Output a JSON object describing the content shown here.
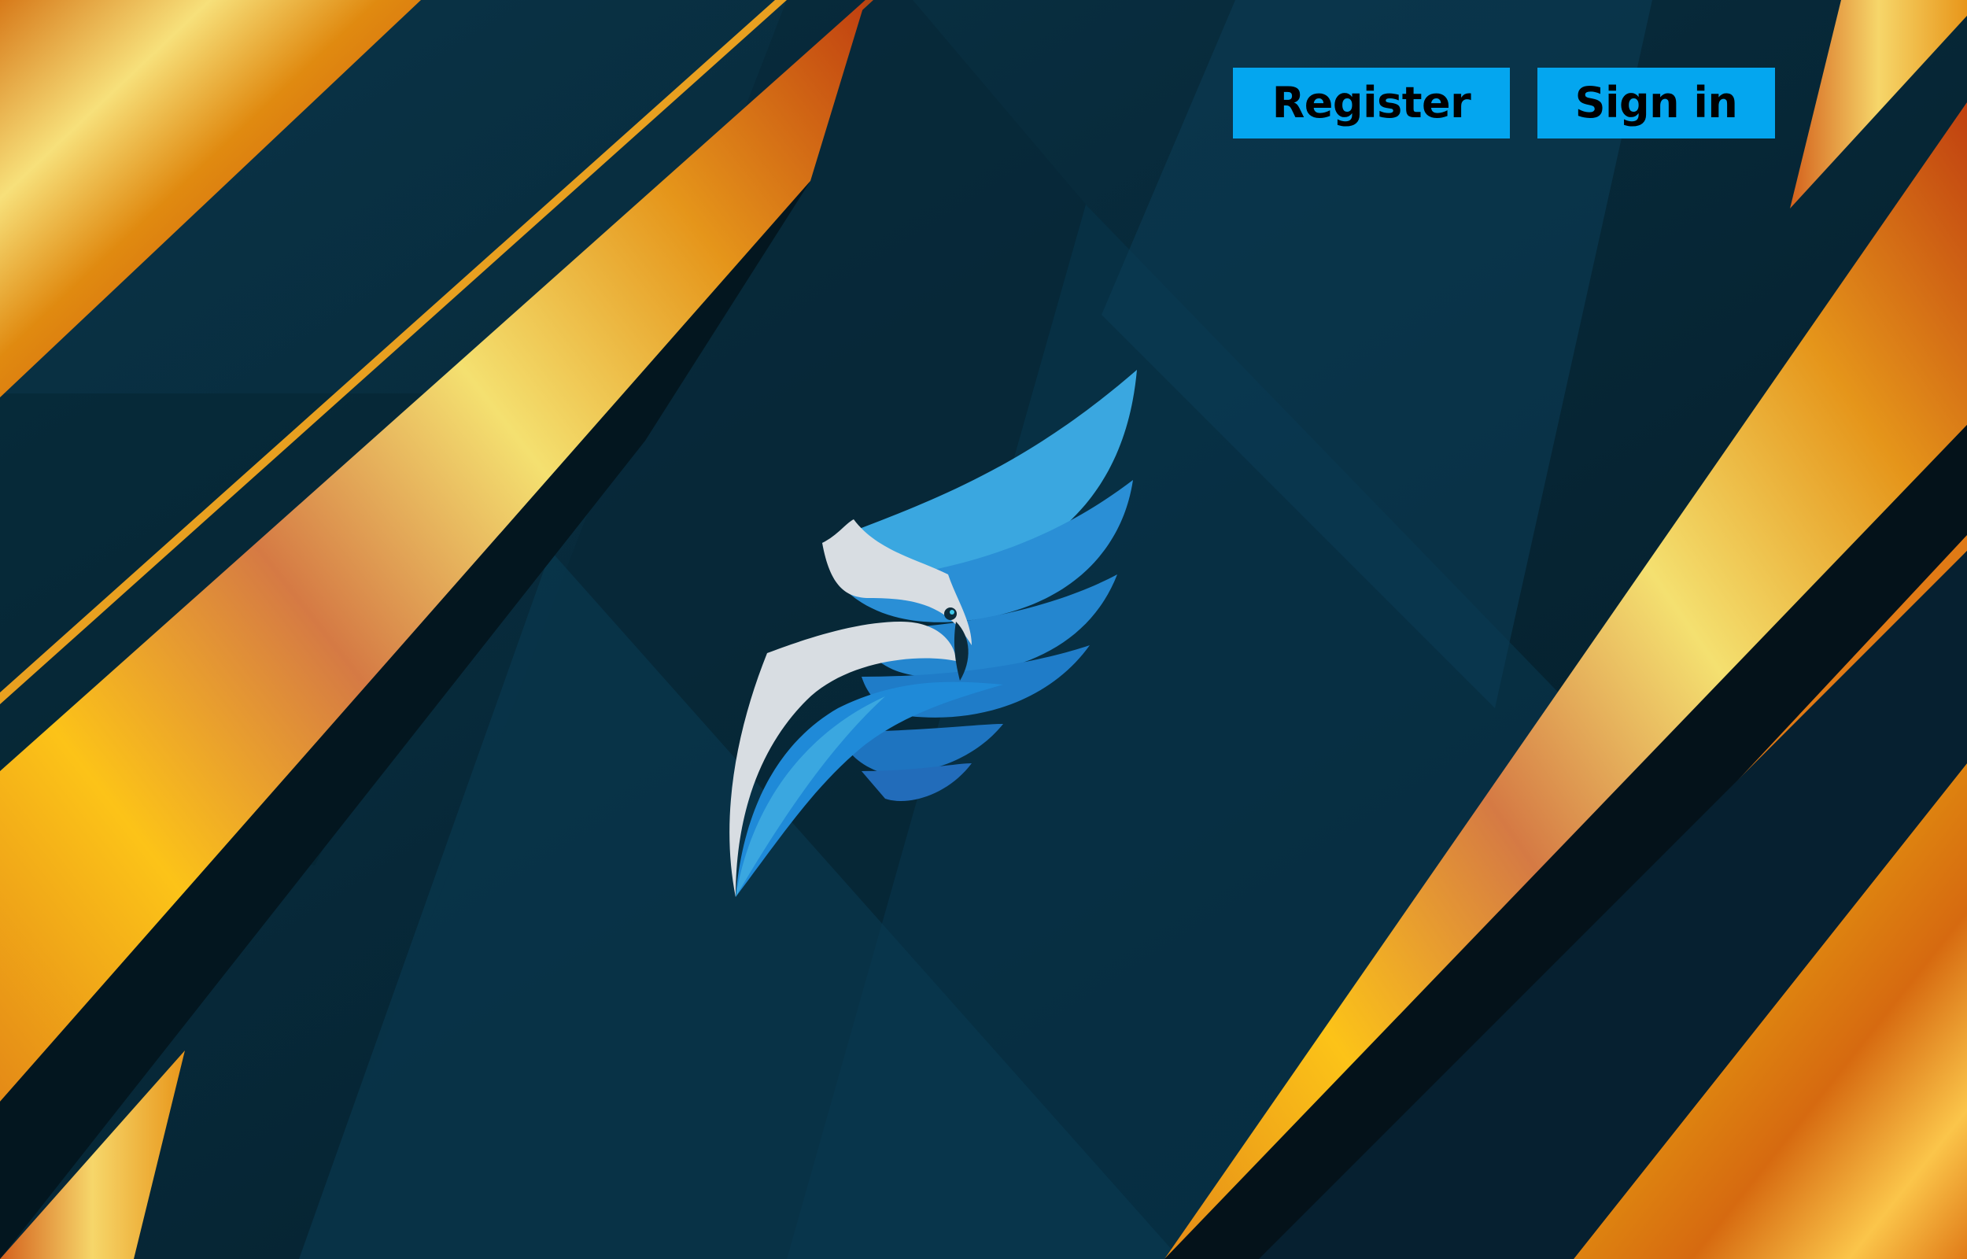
{
  "header": {
    "register_label": "Register",
    "signin_label": "Sign in"
  },
  "logo": {
    "icon": "eagle-wing-logo-icon"
  },
  "colors": {
    "background": "#05212f",
    "accent_button": "#04a6ef",
    "gold": "#f0a020",
    "logo_blue": "#1e8fd8",
    "logo_white": "#d8dde2"
  }
}
